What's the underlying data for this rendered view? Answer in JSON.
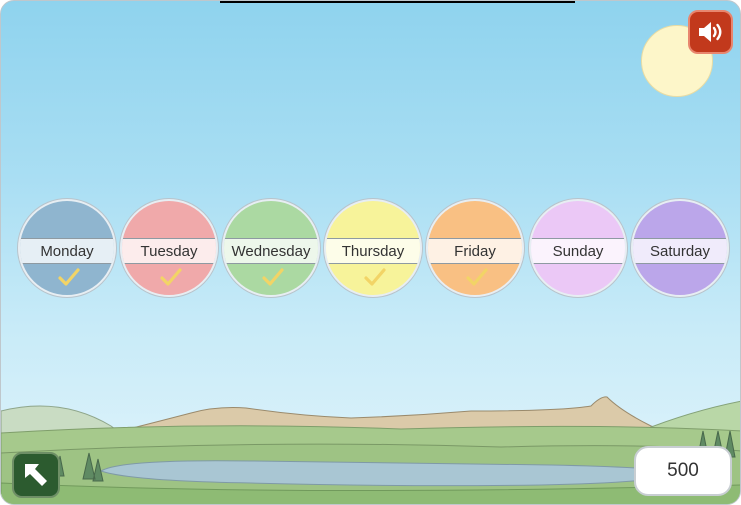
{
  "days": [
    {
      "label": "Monday",
      "color": "#8fb5cf",
      "checked": true
    },
    {
      "label": "Tuesday",
      "color": "#f0a9aa",
      "checked": true
    },
    {
      "label": "Wednesday",
      "color": "#abd9a2",
      "checked": true
    },
    {
      "label": "Thursday",
      "color": "#f7f39a",
      "checked": true
    },
    {
      "label": "Friday",
      "color": "#f9c083",
      "checked": true
    },
    {
      "label": "Sunday",
      "color": "#ebc8f6",
      "checked": false
    },
    {
      "label": "Saturday",
      "color": "#bba6ea",
      "checked": false
    }
  ],
  "score": "500",
  "check_color": "#f2d466",
  "icons": {
    "sound": "speaker-icon",
    "back": "back-arrow-icon"
  }
}
